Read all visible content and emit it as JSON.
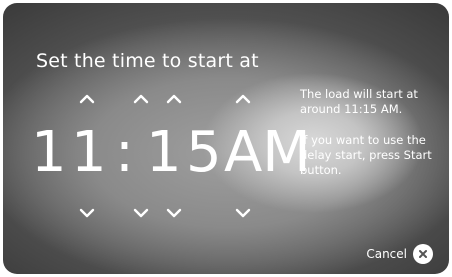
{
  "title": "Set the time to start at",
  "time": {
    "hour_tens": "1",
    "hour_ones": "1",
    "separator": ":",
    "minute_tens": "1",
    "minute_ones": "5",
    "period": "AM"
  },
  "info": {
    "line1": "The load will start at around 11:15 AM.",
    "line2": "If you want to use the delay start, press Start button."
  },
  "cancel_label": "Cancel",
  "icons": {
    "up": "chevron-up-icon",
    "down": "chevron-down-icon",
    "cancel": "close-icon"
  },
  "colors": {
    "text": "#ffffff",
    "background": "#555555"
  }
}
